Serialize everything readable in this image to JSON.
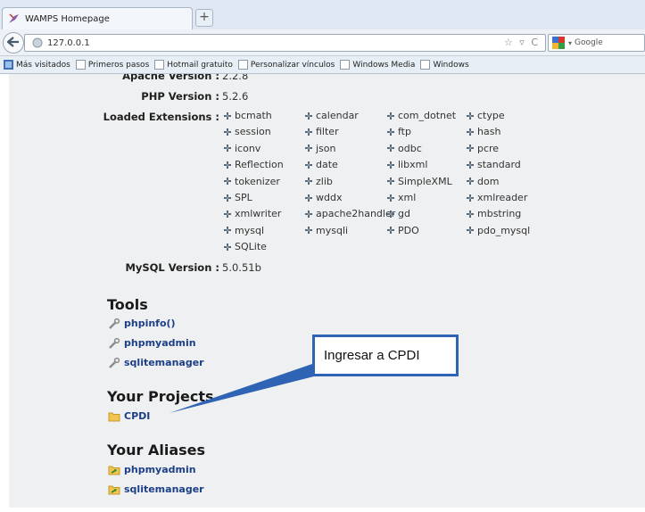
{
  "browser": {
    "tab_title": "WAMPS Homepage",
    "new_tab": "+",
    "url": "127.0.0.1",
    "search_placeholder": "Google",
    "url_controls": "☆ ▿ C",
    "bookmarks": [
      "Más visitados",
      "Primeros pasos",
      "Hotmail gratuito",
      "Personalizar vínculos",
      "Windows Media",
      "Windows"
    ]
  },
  "config": {
    "apache_label": "Apache Version :",
    "apache_value": "2.2.8",
    "php_label": "PHP Version :",
    "php_value": "5.2.6",
    "extensions_label": "Loaded Extensions :",
    "mysql_label": "MySQL Version :",
    "mysql_value": "5.0.51b"
  },
  "extensions": [
    [
      "bcmath",
      "calendar",
      "com_dotnet",
      "ctype"
    ],
    [
      "session",
      "filter",
      "ftp",
      "hash"
    ],
    [
      "iconv",
      "json",
      "odbc",
      "pcre"
    ],
    [
      "Reflection",
      "date",
      "libxml",
      "standard"
    ],
    [
      "tokenizer",
      "zlib",
      "SimpleXML",
      "dom"
    ],
    [
      "SPL",
      "wddx",
      "xml",
      "xmlreader"
    ],
    [
      "xmlwriter",
      "apache2handler",
      "gd",
      "mbstring"
    ],
    [
      "mysql",
      "mysqli",
      "PDO",
      "pdo_mysql"
    ],
    [
      "SQLite"
    ]
  ],
  "tools": {
    "title": "Tools",
    "items": [
      "phpinfo()",
      "phpmyadmin",
      "sqlitemanager"
    ]
  },
  "projects": {
    "title": "Your Projects",
    "items": [
      "CPDI"
    ]
  },
  "aliases": {
    "title": "Your Aliases",
    "items": [
      "phpmyadmin",
      "sqlitemanager"
    ]
  },
  "callout": {
    "text": "Ingresar a CPDI"
  },
  "colors": {
    "link": "#1c3f86",
    "callout_border": "#2f64b5",
    "page_bg": "#eff0f1"
  }
}
